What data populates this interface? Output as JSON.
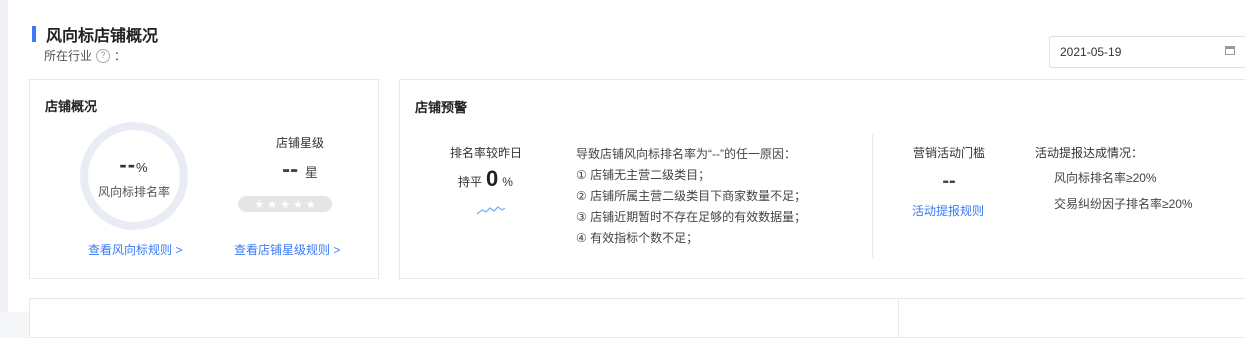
{
  "page": {
    "title": "风向标店铺概况",
    "industry_label": "所在行业",
    "industry_value": "：",
    "date": "2021-05-19"
  },
  "overview": {
    "title": "店铺概况",
    "rank_value": "--",
    "rank_unit": "%",
    "rank_label": "风向标排名率",
    "star_label": "店铺星级",
    "star_value": "--",
    "star_unit": "星",
    "stars_total": 5,
    "rank_rule_link": "查看风向标规则 >",
    "star_rule_link": "查看店铺星级规则 >"
  },
  "warning": {
    "title": "店铺预警",
    "compare_label": "排名率较昨日",
    "compare_status": "持平",
    "compare_value": "0",
    "compare_unit": "%",
    "reasons_title": "导致店铺风向标排名率为“--”的任一原因：",
    "reasons": [
      "① 店铺无主营二级类目；",
      "② 店铺所属主营二级类目下商家数量不足；",
      "③ 店铺近期暂时不存在足够的有效数据量；",
      "④ 有效指标个数不足；"
    ],
    "marketing_label": "营销活动门槛",
    "marketing_value": "--",
    "marketing_link": "活动提报规则",
    "achieve_label": "活动提报达成情况：",
    "achieve_items": [
      "风向标排名率≥20%",
      "交易纠纷因子排名率≥20%"
    ]
  },
  "colors": {
    "accent": "#3a7bf6",
    "ring": "#e9ecf4",
    "sparkline": "#7eb0f5"
  }
}
